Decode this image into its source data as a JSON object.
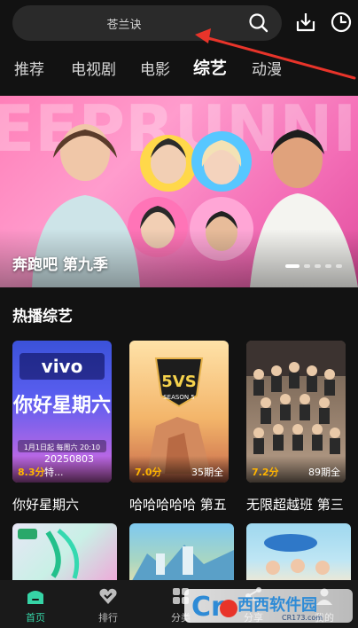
{
  "search": {
    "placeholder_text": "苍兰诀"
  },
  "tabs": [
    {
      "label": "推荐"
    },
    {
      "label": "电视剧"
    },
    {
      "label": "电影"
    },
    {
      "label": "综艺",
      "active": true
    },
    {
      "label": "动漫"
    }
  ],
  "banner": {
    "title": "奔跑吧 第九季",
    "slide_count": 5,
    "active_slide": 1
  },
  "section": {
    "title": "热播综艺"
  },
  "cards": [
    {
      "title": "你好星期六",
      "score": "8.3分",
      "info": "20250803 特...",
      "poster_text": "vivo",
      "poster_sub": "你好星期六",
      "poster_date": "1月1日起 每周六 20:10"
    },
    {
      "title": "哈哈哈哈哈 第五",
      "score": "7.0分",
      "info": "35期全",
      "poster_text": "5VS",
      "poster_sub": "SEASON 5"
    },
    {
      "title": "无限超越班 第三",
      "score": "7.2分",
      "info": "89期全"
    }
  ],
  "bottom_nav": [
    {
      "label": "首页",
      "active": true
    },
    {
      "label": "排行"
    },
    {
      "label": "分类"
    },
    {
      "label": "分享"
    },
    {
      "label": "我的"
    }
  ],
  "watermark": {
    "text": "西西软件园",
    "url": "CR173.com"
  },
  "colors": {
    "background": "#121212",
    "accent_red": "#ff4a3d",
    "active_nav": "#36d4a6",
    "score_yellow": "#ffb400"
  }
}
